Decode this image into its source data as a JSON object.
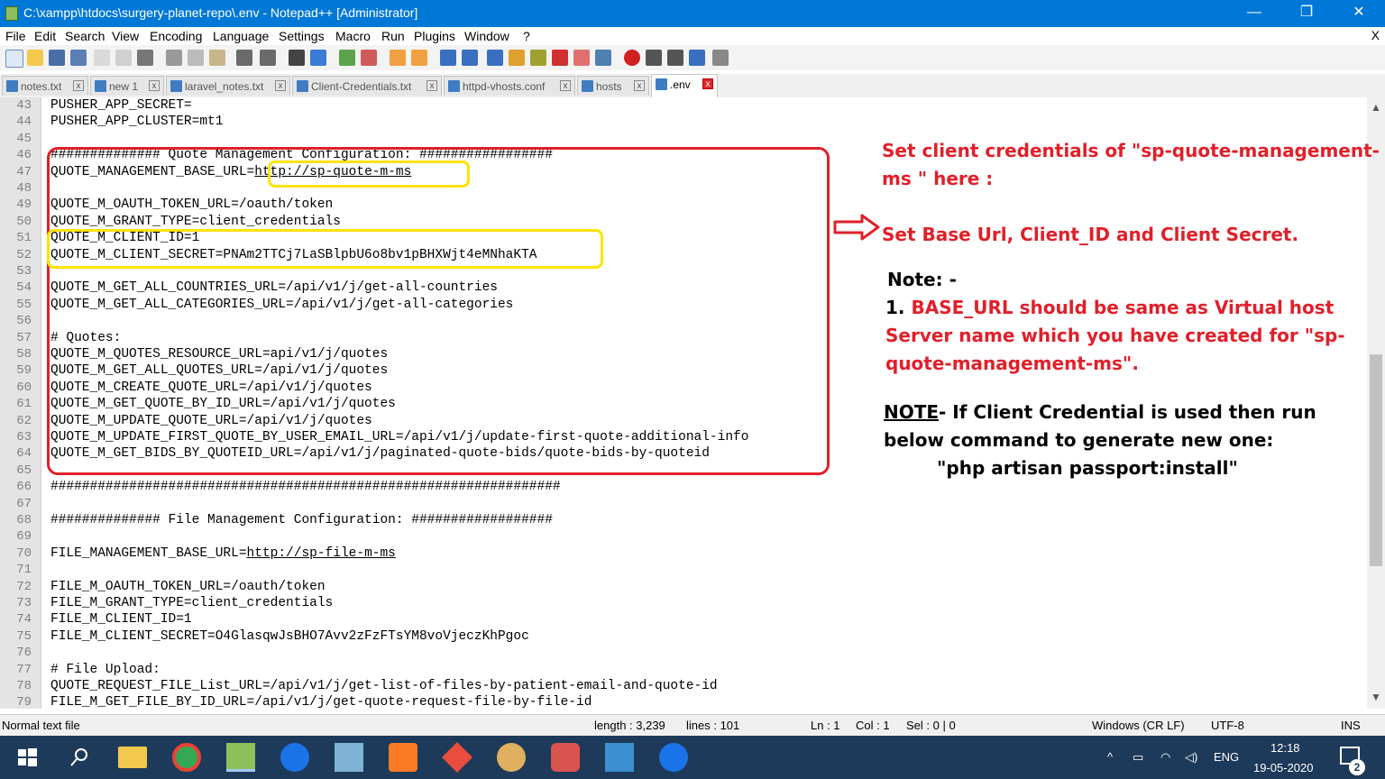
{
  "window": {
    "title": "C:\\xampp\\htdocs\\surgery-planet-repo\\.env - Notepad++ [Administrator]",
    "minimize": "—",
    "restore": "❐",
    "close": "✕"
  },
  "menu": [
    "File",
    "Edit",
    "Search",
    "View",
    "Encoding",
    "Language",
    "Settings",
    "Macro",
    "Run",
    "Plugins",
    "Window",
    "?"
  ],
  "menu_close": "X",
  "tabs": [
    {
      "label": "notes.txt"
    },
    {
      "label": "new 1"
    },
    {
      "label": "laravel_notes.txt"
    },
    {
      "label": "Client-Credentials.txt"
    },
    {
      "label": "httpd-vhosts.conf"
    },
    {
      "label": "hosts"
    },
    {
      "label": ".env",
      "active": true
    }
  ],
  "tab_close": "x",
  "editor": {
    "lines": [
      {
        "n": "43",
        "t": "PUSHER_APP_SECRET="
      },
      {
        "n": "44",
        "t": "PUSHER_APP_CLUSTER=mt1"
      },
      {
        "n": "45",
        "t": ""
      },
      {
        "n": "46",
        "t": "############## Quote Management Configuration: #################"
      },
      {
        "n": "47",
        "t": "QUOTE_MANAGEMENT_BASE_URL=",
        "link": "http://sp-quote-m-ms"
      },
      {
        "n": "48",
        "t": ""
      },
      {
        "n": "49",
        "t": "QUOTE_M_OAUTH_TOKEN_URL=/oauth/token"
      },
      {
        "n": "50",
        "t": "QUOTE_M_GRANT_TYPE=client_credentials"
      },
      {
        "n": "51",
        "t": "QUOTE_M_CLIENT_ID=1"
      },
      {
        "n": "52",
        "t": "QUOTE_M_CLIENT_SECRET=PNAm2TTCj7LaSBlpbU6o8bv1pBHXWjt4eMNhaKTA"
      },
      {
        "n": "53",
        "t": ""
      },
      {
        "n": "54",
        "t": "QUOTE_M_GET_ALL_COUNTRIES_URL=/api/v1/j/get-all-countries"
      },
      {
        "n": "55",
        "t": "QUOTE_M_GET_ALL_CATEGORIES_URL=/api/v1/j/get-all-categories"
      },
      {
        "n": "56",
        "t": ""
      },
      {
        "n": "57",
        "t": "# Quotes:"
      },
      {
        "n": "58",
        "t": "QUOTE_M_QUOTES_RESOURCE_URL=api/v1/j/quotes"
      },
      {
        "n": "59",
        "t": "QUOTE_M_GET_ALL_QUOTES_URL=/api/v1/j/quotes"
      },
      {
        "n": "60",
        "t": "QUOTE_M_CREATE_QUOTE_URL=/api/v1/j/quotes"
      },
      {
        "n": "61",
        "t": "QUOTE_M_GET_QUOTE_BY_ID_URL=/api/v1/j/quotes"
      },
      {
        "n": "62",
        "t": "QUOTE_M_UPDATE_QUOTE_URL=/api/v1/j/quotes"
      },
      {
        "n": "63",
        "t": "QUOTE_M_UPDATE_FIRST_QUOTE_BY_USER_EMAIL_URL=/api/v1/j/update-first-quote-additional-info"
      },
      {
        "n": "64",
        "t": "QUOTE_M_GET_BIDS_BY_QUOTEID_URL=/api/v1/j/paginated-quote-bids/quote-bids-by-quoteid"
      },
      {
        "n": "65",
        "t": ""
      },
      {
        "n": "66",
        "t": "#################################################################"
      },
      {
        "n": "67",
        "t": ""
      },
      {
        "n": "68",
        "t": "############## File Management Configuration: ##################"
      },
      {
        "n": "69",
        "t": ""
      },
      {
        "n": "70",
        "t": "FILE_MANAGEMENT_BASE_URL=",
        "link": "http://sp-file-m-ms"
      },
      {
        "n": "71",
        "t": ""
      },
      {
        "n": "72",
        "t": "FILE_M_OAUTH_TOKEN_URL=/oauth/token"
      },
      {
        "n": "73",
        "t": "FILE_M_GRANT_TYPE=client_credentials"
      },
      {
        "n": "74",
        "t": "FILE_M_CLIENT_ID=1"
      },
      {
        "n": "75",
        "t": "FILE_M_CLIENT_SECRET=O4GlasqwJsBHO7Avv2zFzFTsYM8voVjeczKhPgoc"
      },
      {
        "n": "76",
        "t": ""
      },
      {
        "n": "77",
        "t": "# File Upload:"
      },
      {
        "n": "78",
        "t": "QUOTE_REQUEST_FILE_List_URL=/api/v1/j/get-list-of-files-by-patient-email-and-quote-id"
      },
      {
        "n": "79",
        "t": "FILE_M_GET_FILE_BY_ID_URL=/api/v1/j/get-quote-request-file-by-file-id"
      }
    ]
  },
  "annotations": {
    "line1": "Set client credentials of \"sp-quote-management-",
    "line2": "ms \" here :",
    "line3": "Set Base Url, Client_ID and Client Secret.",
    "note_label": "Note: -",
    "point_num": "1.",
    "point_l1": "BASE_URL should be same as Virtual host",
    "point_l2": "Server name which you have created for \"sp-",
    "point_l3": "quote-management-ms\".",
    "note2_label": "NOTE",
    "note2_rest": "- If Client Credential is used then run",
    "note2_l2": "below command to generate new one:",
    "note2_cmd": "\"php artisan passport:install\"",
    "red_color": "#e0202a",
    "yellow_color": "#ffe200"
  },
  "status": {
    "type": "Normal text file",
    "length": "length : 3,239",
    "lines": "lines : 101",
    "ln": "Ln : 1",
    "col": "Col : 1",
    "sel": "Sel : 0 | 0",
    "eol": "Windows (CR LF)",
    "enc": "UTF-8",
    "mode": "INS"
  },
  "taskbar": {
    "lang": "ENG",
    "time": "12:18",
    "date": "19-05-2020",
    "notif": "2"
  }
}
